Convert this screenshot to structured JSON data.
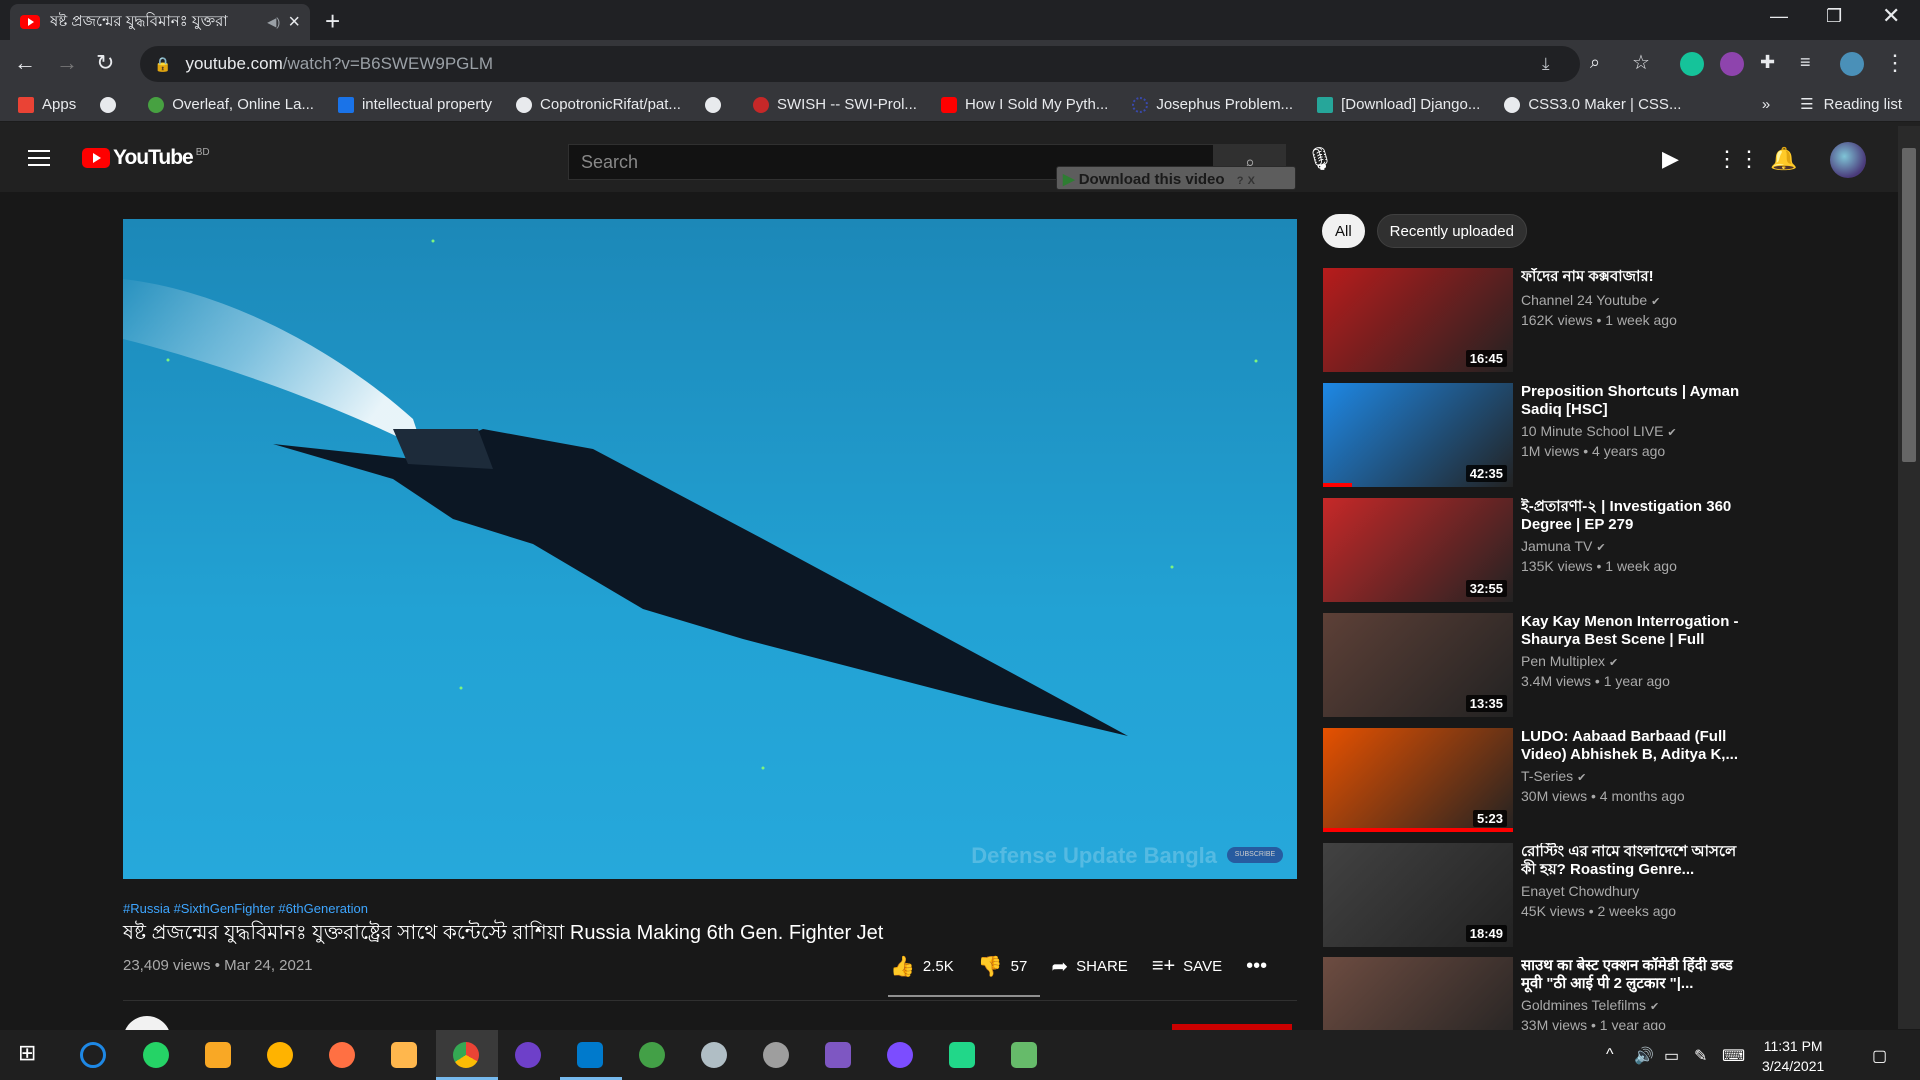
{
  "browser": {
    "tab_title": "ষষ্ট প্রজন্মের যুদ্ধবিমানঃ যুক্তরা",
    "url_host": "youtube.com",
    "url_path": "/watch?v=B6SWEW9PGLM"
  },
  "bookmarks": [
    {
      "label": "Apps",
      "color": "#ea4335"
    },
    {
      "label": "",
      "color": "#e8eaed"
    },
    {
      "label": "Overleaf, Online La...",
      "color": "#47a141"
    },
    {
      "label": "intellectual property",
      "color": "#1a73e8"
    },
    {
      "label": "CopotronicRifat/pat...",
      "color": "#e8eaed"
    },
    {
      "label": "",
      "color": "#e8eaed"
    },
    {
      "label": "SWISH -- SWI-Prol...",
      "color": "#c62828"
    },
    {
      "label": "How I Sold My Pyth...",
      "color": "#ff0000"
    },
    {
      "label": "Josephus Problem...",
      "color": "#3949ab"
    },
    {
      "label": "[Download] Django...",
      "color": "#26a69a"
    },
    {
      "label": "CSS3.0 Maker | CSS...",
      "color": "#e8eaed"
    }
  ],
  "reading_list": "Reading list",
  "youtube": {
    "logo": "YouTube",
    "country": "BD",
    "search_placeholder": "Search",
    "download_bar": "Download this video"
  },
  "video": {
    "hashtags": "#Russia #SixthGenFighter #6thGeneration",
    "title": "ষষ্ট প্রজন্মের যুদ্ধবিমানঃ যুক্তরাষ্ট্রের সাথে কন্টেস্টে রাশিয়া Russia Making 6th Gen. Fighter Jet",
    "views": "23,409 views • Mar 24, 2021",
    "likes": "2.5K",
    "dislikes": "57",
    "share": "SHARE",
    "save": "SAVE",
    "watermark": "Defense Update Bangla",
    "subscribe_watermark": "SUBSCRIBE"
  },
  "chips": [
    "All",
    "Recently uploaded"
  ],
  "recommendations": [
    {
      "title": "ফাঁদের নাম কক্সবাজার!",
      "channel": "Channel 24 Youtube",
      "meta": "162K views • 1 week ago",
      "duration": "16:45",
      "thumb_color": "#b71c1c",
      "progress": 0
    },
    {
      "title": "Preposition Shortcuts | Ayman Sadiq [HSC]",
      "channel": "10 Minute School LIVE",
      "meta": "1M views • 4 years ago",
      "duration": "42:35",
      "thumb_color": "#1e88e5",
      "progress": 0.15
    },
    {
      "title": "ই-প্রতারণা-২ | Investigation 360 Degree | EP 279",
      "channel": "Jamuna TV",
      "meta": "135K views • 1 week ago",
      "duration": "32:55",
      "thumb_color": "#c62828",
      "progress": 0
    },
    {
      "title": "Kay Kay Menon Interrogation - Shaurya Best Scene | Full Hind...",
      "channel": "Pen Multiplex",
      "meta": "3.4M views • 1 year ago",
      "duration": "13:35",
      "thumb_color": "#5d4037",
      "progress": 0
    },
    {
      "title": "LUDO: Aabaad Barbaad (Full Video) Abhishek B, Aditya K,...",
      "channel": "T-Series",
      "meta": "30M views • 4 months ago",
      "duration": "5:23",
      "thumb_color": "#e65100",
      "progress": 1.0
    },
    {
      "title": "রোস্টিং এর নামে বাংলাদেশে আসলে কী হয়? Roasting Genre...",
      "channel": "Enayet Chowdhury",
      "meta": "45K views • 2 weeks ago",
      "duration": "18:49",
      "thumb_color": "#424242",
      "progress": 0
    },
    {
      "title": "साउथ का बेस्ट एक्शन कॉमेडी हिंदी डब्ड मूवी \"ठी आई पी 2 लुटकार \"|...",
      "channel": "Goldmines Telefilms",
      "meta": "33M views • 1 year ago",
      "duration": "",
      "thumb_color": "#6d4c41",
      "progress": 0
    }
  ],
  "taskbar": {
    "time": "11:31 PM",
    "date": "3/24/2021"
  }
}
